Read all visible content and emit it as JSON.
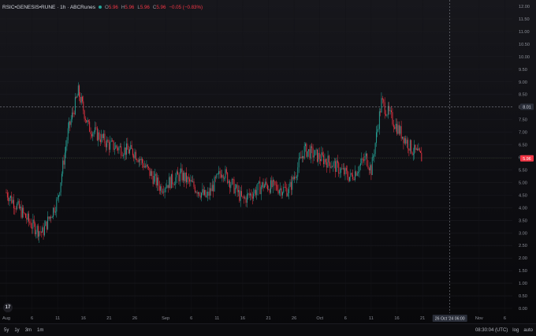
{
  "legend": {
    "symbol": "RSIC•GENESIS•RUNE · 1h · ABCRunes",
    "open": "5.96",
    "high": "5.96",
    "low": "5.96",
    "close": "5.96",
    "change": "−0.05 (−0.83%)"
  },
  "price_axis": [
    "12.00",
    "11.50",
    "11.00",
    "10.50",
    "10.00",
    "9.50",
    "9.00",
    "8.50",
    "8.00",
    "7.50",
    "7.00",
    "6.50",
    "6.00",
    "5.50",
    "5.00",
    "4.50",
    "4.00",
    "3.50",
    "3.00",
    "2.50",
    "2.00",
    "1.50",
    "1.00",
    "0.50",
    "0.00"
  ],
  "time_axis": [
    "Aug",
    "6",
    "11",
    "16",
    "21",
    "26",
    "Sep",
    "6",
    "11",
    "16",
    "21",
    "26",
    "Oct",
    "6",
    "11",
    "16",
    "21",
    "Nov",
    "6"
  ],
  "crosshair": {
    "price": "8.01",
    "time": "26 Oct '24  06:00"
  },
  "last_price": "5.96",
  "bottom_bar": {
    "ranges": [
      "5y",
      "1y",
      "3m",
      "1m"
    ],
    "clock": "08:30:04 (UTC)",
    "log": "log",
    "auto": "auto"
  },
  "logo_text": "17",
  "colors": {
    "up": "#26a69a",
    "down": "#f23645",
    "crosshair": "#9598a1"
  },
  "chart_data": {
    "type": "candlestick",
    "interval": "1h",
    "ylim": [
      0,
      12
    ],
    "x_range": [
      "Aug 1",
      "Nov 7"
    ],
    "path_points": [
      {
        "date": "Aug 1",
        "price": 4.6
      },
      {
        "date": "Aug 6",
        "price": 3.3
      },
      {
        "date": "Aug 8",
        "price": 3.0
      },
      {
        "date": "Aug 11",
        "price": 4.3
      },
      {
        "date": "Aug 13",
        "price": 7.0
      },
      {
        "date": "Aug 15",
        "price": 8.6
      },
      {
        "date": "Aug 17",
        "price": 7.2
      },
      {
        "date": "Aug 21",
        "price": 6.5
      },
      {
        "date": "Aug 24",
        "price": 6.3
      },
      {
        "date": "Aug 26",
        "price": 6.2
      },
      {
        "date": "Aug 31",
        "price": 4.8
      },
      {
        "date": "Sep 4",
        "price": 5.3
      },
      {
        "date": "Sep 9",
        "price": 4.4
      },
      {
        "date": "Sep 12",
        "price": 5.5
      },
      {
        "date": "Sep 16",
        "price": 4.3
      },
      {
        "date": "Sep 20",
        "price": 4.9
      },
      {
        "date": "Sep 25",
        "price": 4.7
      },
      {
        "date": "Sep 28",
        "price": 6.3
      },
      {
        "date": "Oct 3",
        "price": 5.8
      },
      {
        "date": "Oct 7",
        "price": 5.2
      },
      {
        "date": "Oct 10",
        "price": 6.0
      },
      {
        "date": "Oct 11",
        "price": 5.5
      },
      {
        "date": "Oct 13",
        "price": 8.2
      },
      {
        "date": "Oct 16",
        "price": 7.2
      },
      {
        "date": "Oct 19",
        "price": 6.3
      },
      {
        "date": "Oct 21",
        "price": 5.96
      }
    ]
  }
}
